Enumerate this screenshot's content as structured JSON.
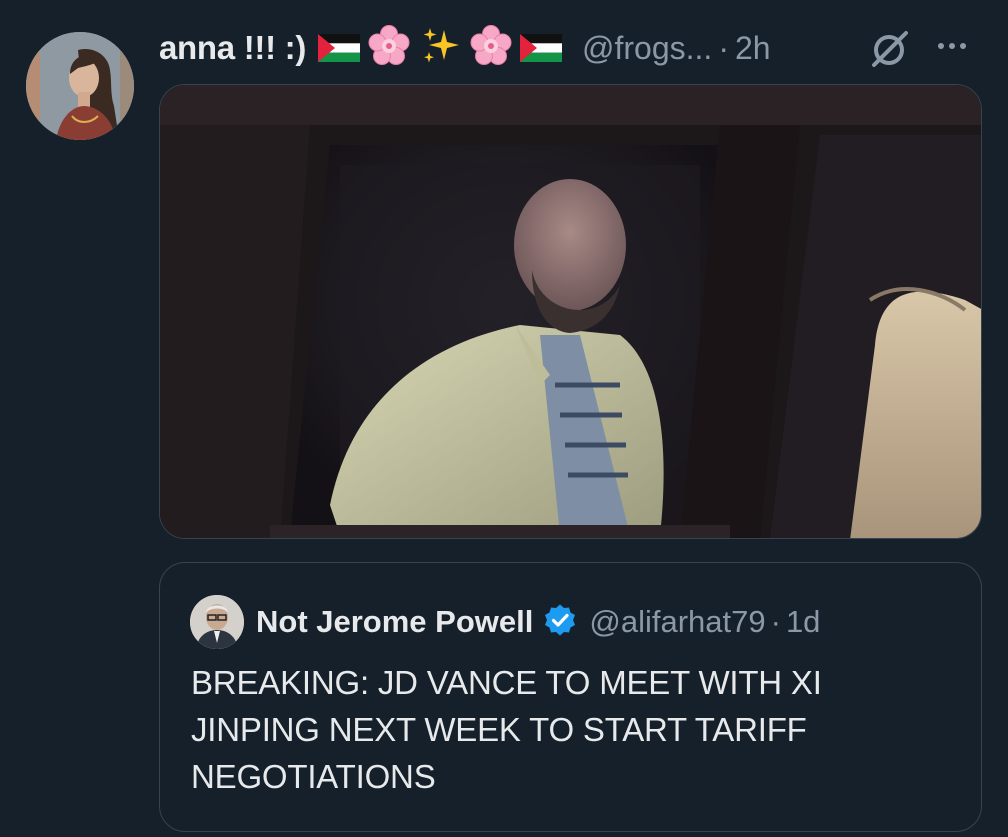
{
  "tweet": {
    "display_name": "anna !!! :)",
    "handle": "@frogs...",
    "separator": "·",
    "time": "2h",
    "emoji": [
      "palestine-flag",
      "cherry-blossom",
      "sparkles",
      "cherry-blossom",
      "palestine-flag"
    ]
  },
  "quoted_tweet": {
    "display_name": "Not Jerome Powell",
    "handle": "@alifarhat79",
    "separator": "·",
    "time": "1d",
    "text": "BREAKING: JD VANCE TO MEET WITH XI JINPING NEXT WEEK TO START TARIFF NEGOTIATIONS"
  },
  "icons": {
    "grok": "grok-icon",
    "more": "more-options-icon",
    "verified": "verified-badge-icon"
  },
  "colors": {
    "background": "#15202b",
    "border": "#38444d",
    "secondary_text": "#8b98a5",
    "primary_text": "#e7e9ea",
    "verified_blue": "#1d9bf0"
  }
}
